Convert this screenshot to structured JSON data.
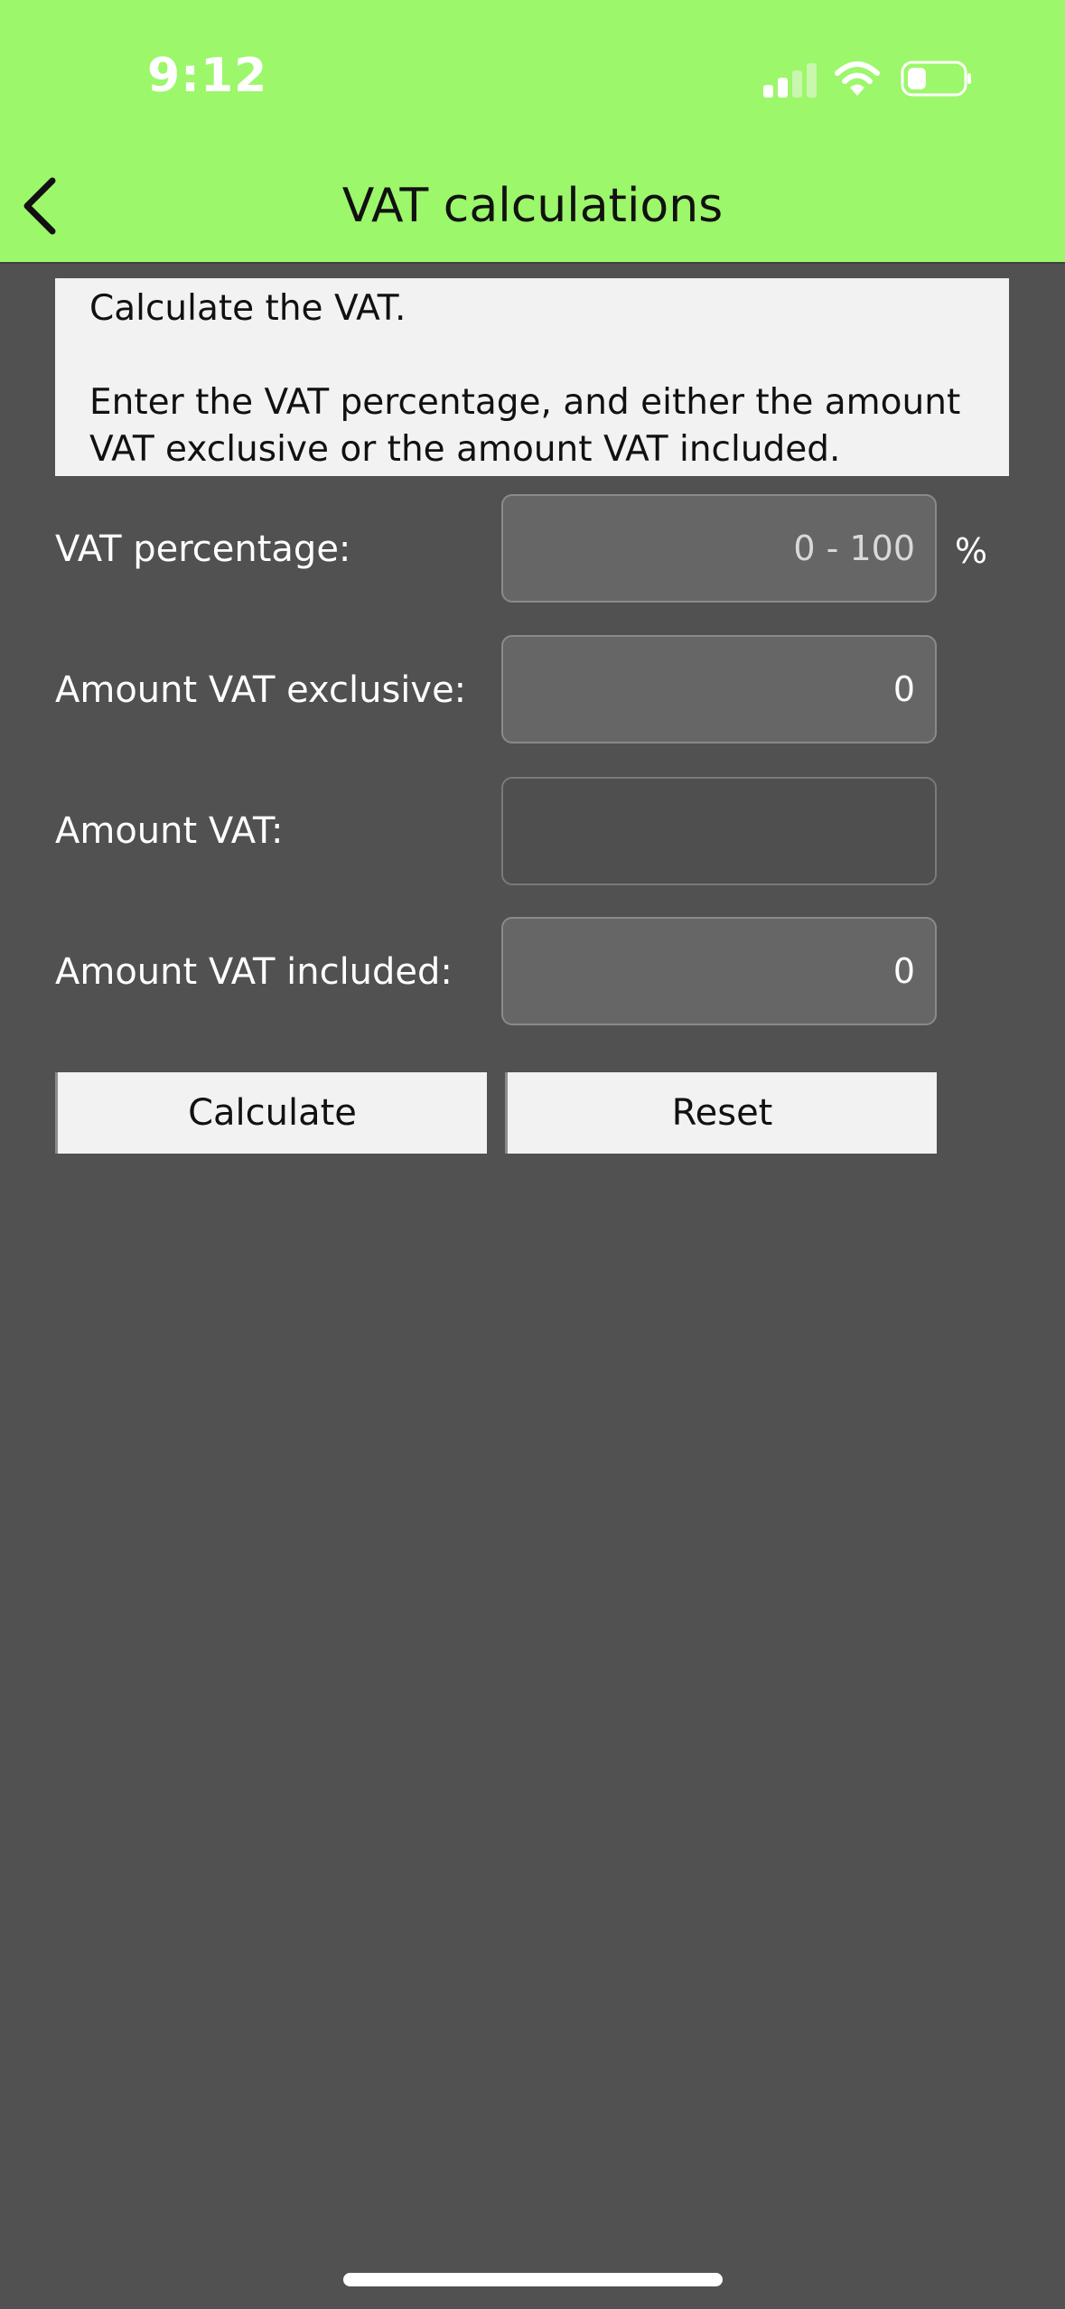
{
  "status_bar": {
    "time": "9:12",
    "icons": [
      "cellular-signal-icon",
      "wifi-icon",
      "battery-icon"
    ]
  },
  "nav": {
    "back_icon": "chevron-left-icon",
    "title": "VAT calculations"
  },
  "info": {
    "line1": "Calculate the VAT.",
    "line2": "Enter the VAT percentage, and either the amount VAT exclusive or the amount VAT included."
  },
  "form": {
    "vat_percentage": {
      "label": "VAT percentage:",
      "value": "",
      "placeholder": "0 - 100",
      "unit": "%"
    },
    "amount_exclusive": {
      "label": "Amount VAT exclusive:",
      "value": "0"
    },
    "amount_vat": {
      "label": "Amount VAT:",
      "value": ""
    },
    "amount_included": {
      "label": "Amount VAT included:",
      "value": "0"
    }
  },
  "buttons": {
    "calculate": "Calculate",
    "reset": "Reset"
  },
  "colors": {
    "header_bg": "#9cf76b",
    "page_bg": "#515151",
    "field_bg": "#666666",
    "button_bg": "#f2f2f2"
  }
}
